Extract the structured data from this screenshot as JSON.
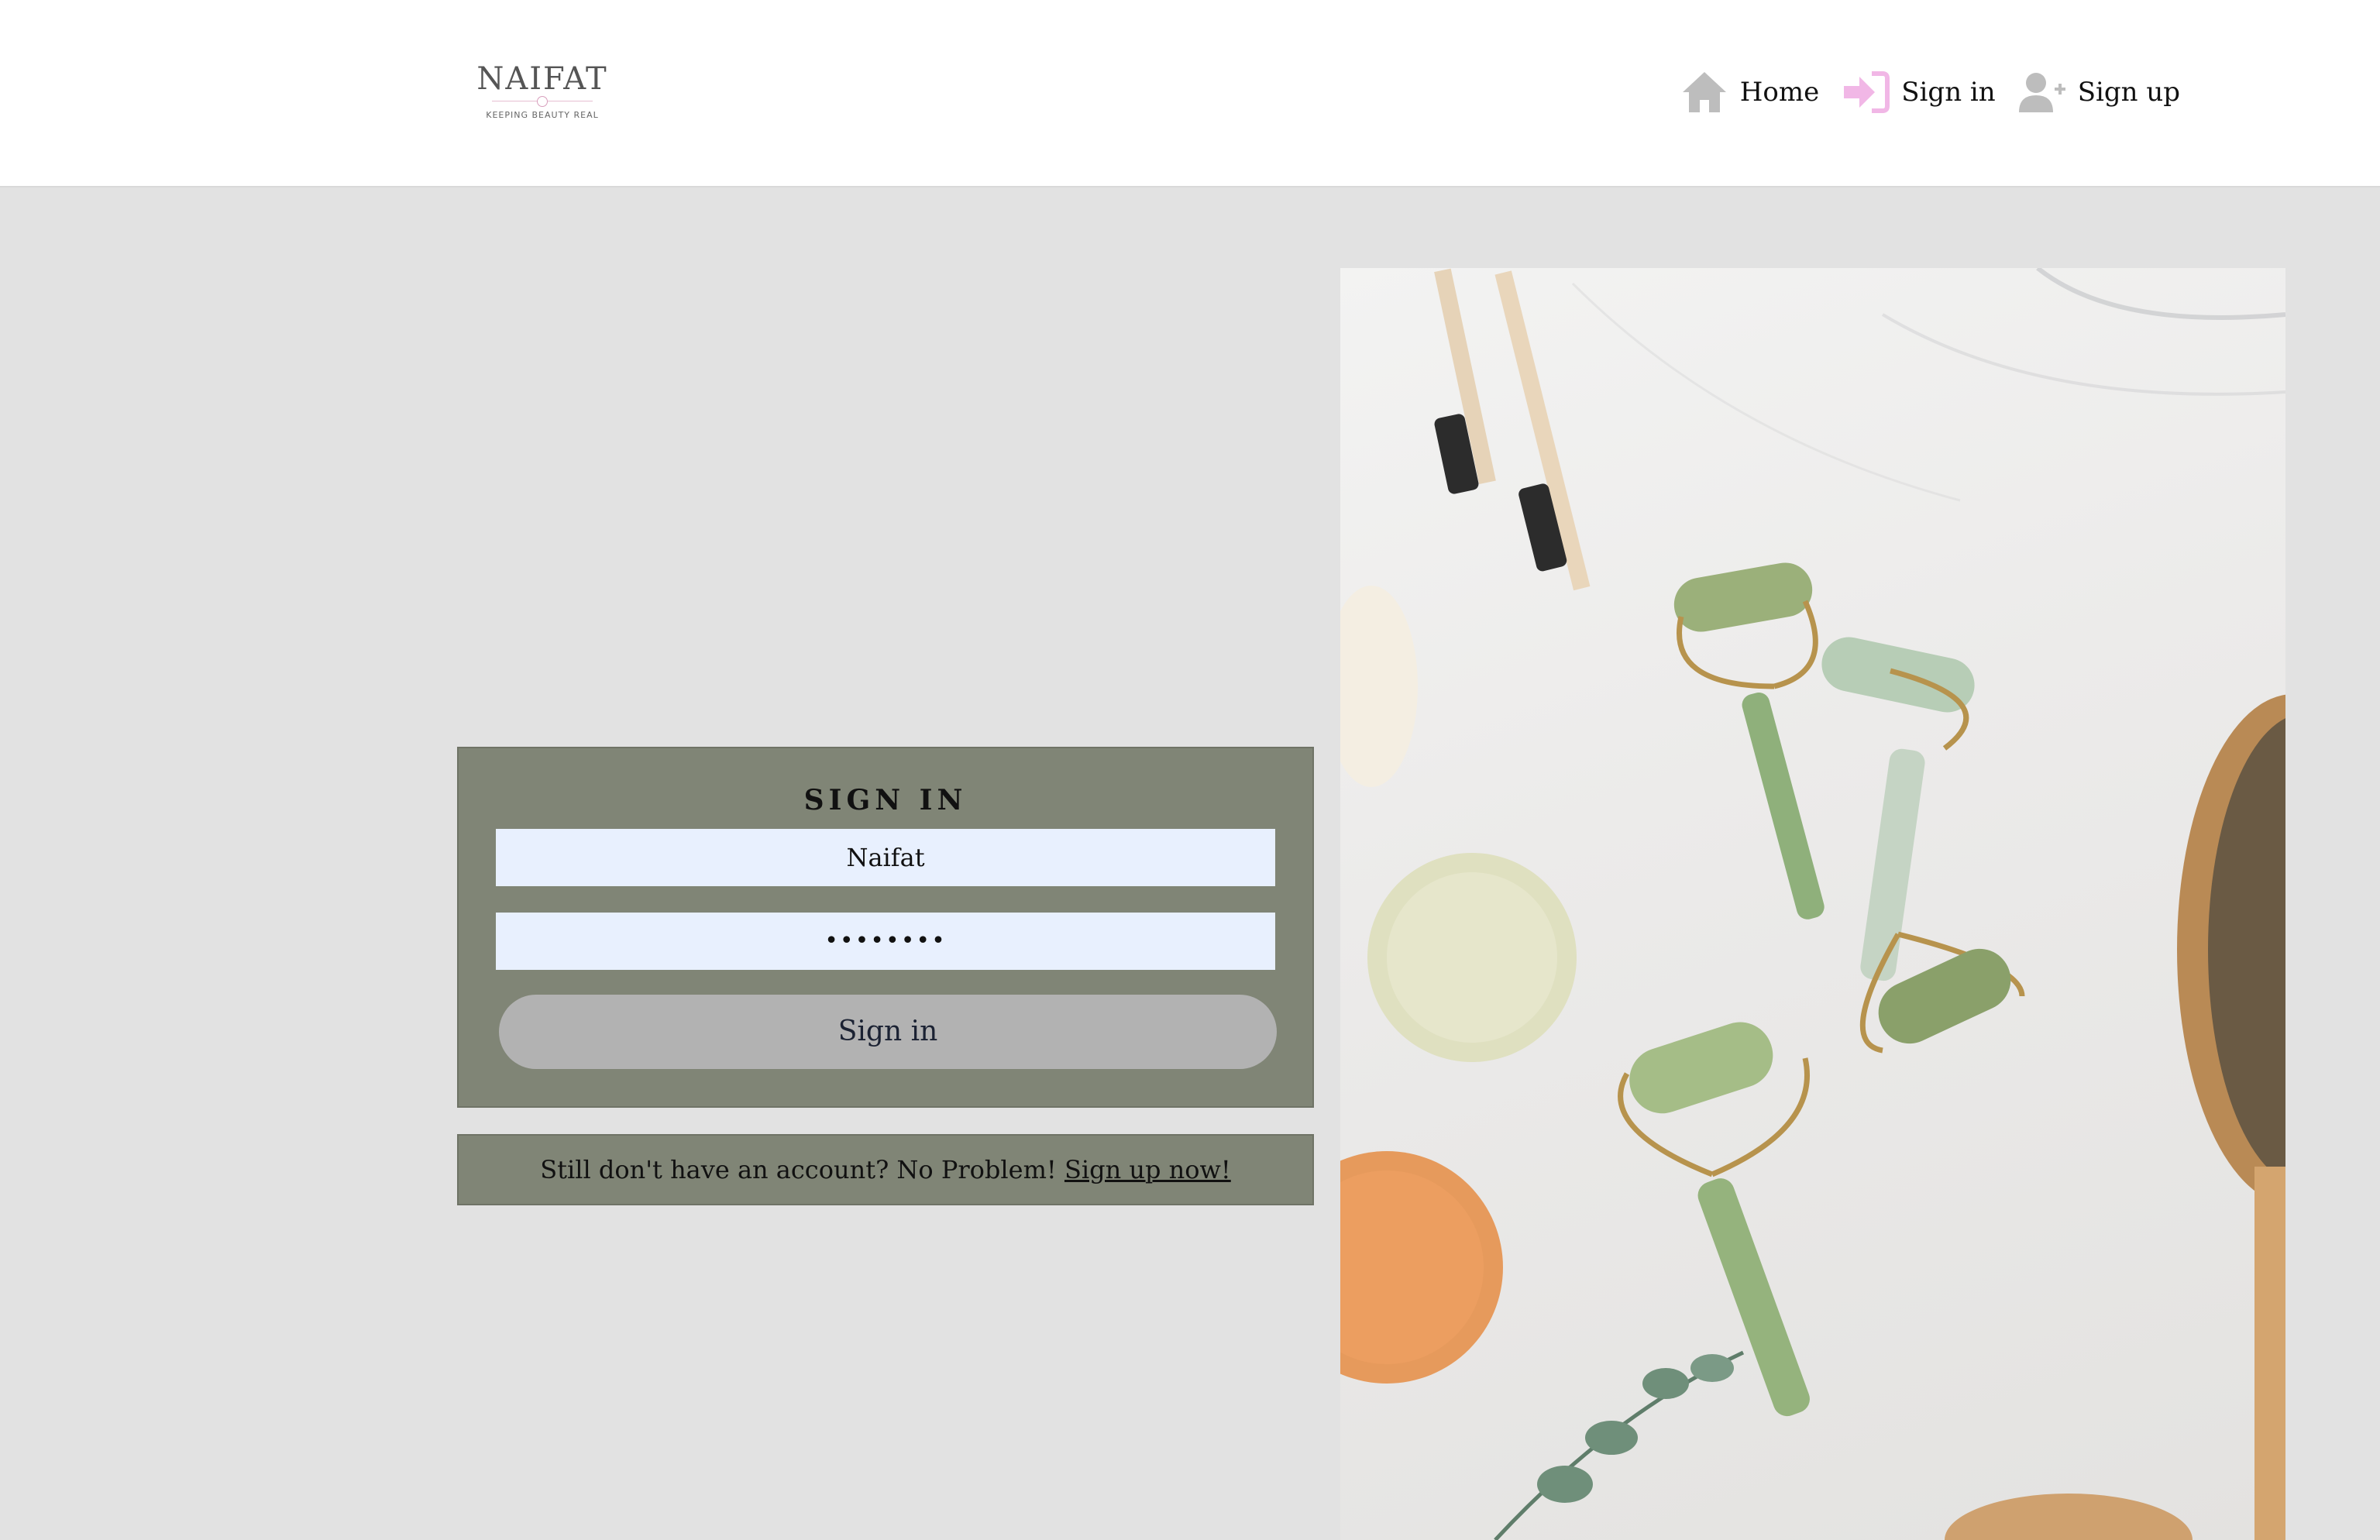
{
  "header": {
    "logo": {
      "wordmark": "NAIFAT",
      "tagline": "KEEPING BEAUTY REAL"
    },
    "nav": [
      {
        "label": "Home",
        "icon": "home-icon",
        "color": "#bdbdbd"
      },
      {
        "label": "Sign in",
        "icon": "sign-in-icon",
        "color": "#f1b7e6"
      },
      {
        "label": "Sign up",
        "icon": "add-user-icon",
        "color": "#bdbdbd"
      }
    ]
  },
  "signin": {
    "title": "SIGN IN",
    "username_value": "Naifat",
    "password_mask": "••••••••",
    "button_label": "Sign in"
  },
  "signup_prompt": {
    "text": "Still don't have an account? No Problem! ",
    "link_label": "Sign up now!"
  },
  "colors": {
    "panel": "#808576",
    "input": "#e8f0fe",
    "button": "#b2b2b2",
    "page_bg": "#e2e2e2"
  },
  "hero_image": {
    "icon": "beauty-products-photo"
  }
}
